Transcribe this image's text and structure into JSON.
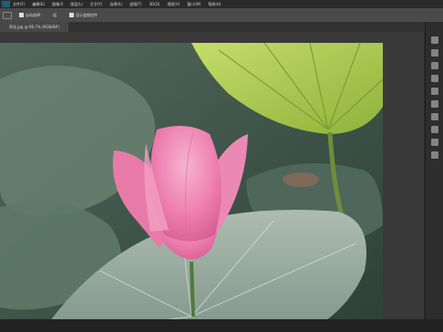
{
  "menubar": {
    "items": [
      "文件(F)",
      "编辑(E)",
      "图像(I)",
      "图层(L)",
      "文字(Y)",
      "选择(S)",
      "滤镜(T)",
      "3D(D)",
      "视图(V)",
      "窗口(W)",
      "帮助(H)"
    ]
  },
  "optionsbar": {
    "auto_select_label": "自动选择：",
    "group_label": "组",
    "show_transform_label": "显示变换控件"
  },
  "document_tab": {
    "label": "荷花.jpg @ 66.7% (RGB/8#)"
  },
  "icons": {
    "app": "photoshop-logo-icon",
    "tool": "move-tool-icon"
  },
  "colors": {
    "chrome_dark": "#2a2a2a",
    "panel": "#4a4a4a",
    "lotus_pink": "#f08ab8",
    "leaf_green": "#a6c84a"
  }
}
